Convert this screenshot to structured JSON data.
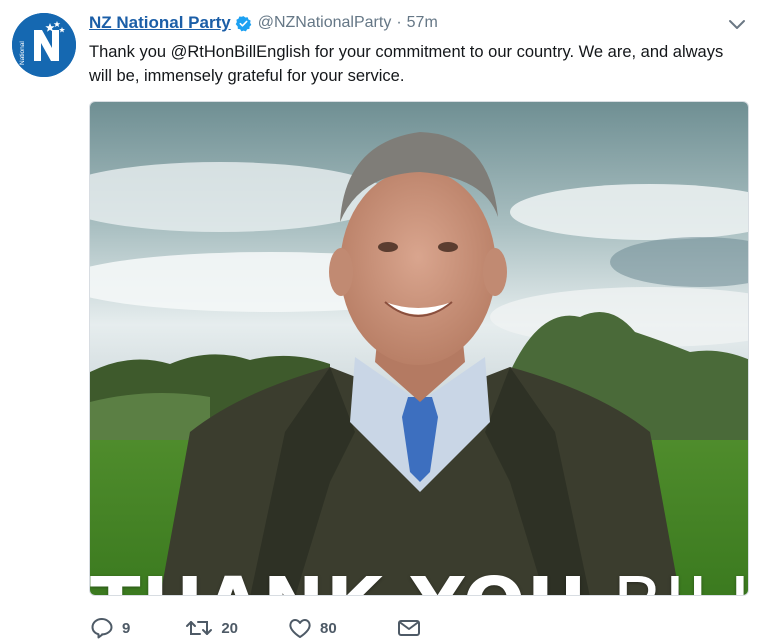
{
  "tweet": {
    "display_name": "NZ National Party",
    "handle": "@NZNationalParty",
    "separator": "·",
    "time": "57m",
    "text": "Thank you @RtHonBillEnglish for your commitment to our country. We are, and always will be, immensely grateful for your service.",
    "avatar_text": "National",
    "image_overlay": {
      "bold": "THANK YOU",
      "light": "BILL"
    }
  },
  "actions": {
    "reply_count": "9",
    "retweet_count": "20",
    "like_count": "80"
  },
  "icons": {
    "verified": "verified-badge-icon",
    "caret": "chevron-down-icon",
    "reply": "reply-icon",
    "retweet": "retweet-icon",
    "like": "heart-icon",
    "dm": "envelope-icon"
  },
  "colors": {
    "name_link": "#1b5ea7",
    "avatar_bg": "#1568b1",
    "verified": "#1da1f2",
    "muted": "#657786"
  }
}
